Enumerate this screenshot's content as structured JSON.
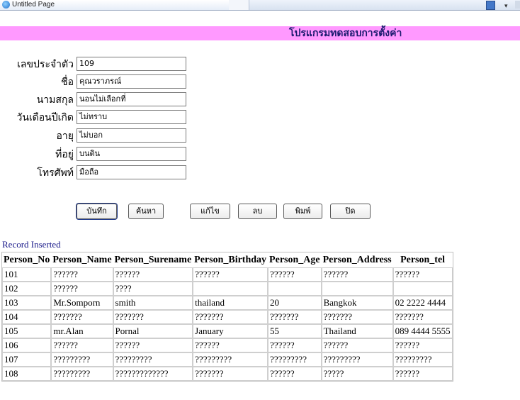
{
  "browser": {
    "tab_title": "Untitled Page"
  },
  "header": {
    "title": "โปรแกรมทดสอบการตั้งค่า",
    "background": "#ff99ff"
  },
  "form": {
    "fields": [
      {
        "label": "เลขประจำตัว",
        "value": "109"
      },
      {
        "label": "ชื่อ",
        "value": "คุณวราภรณ์"
      },
      {
        "label": "นามสกุล",
        "value": "นอนไม่เลือกที่"
      },
      {
        "label": "วันเดือนปีเกิด",
        "value": "ไม่ทราบ"
      },
      {
        "label": "อายุ",
        "value": "ไม่บอก"
      },
      {
        "label": "ที่อยู่",
        "value": "บนดิน"
      },
      {
        "label": "โทรศัพท์",
        "value": "มือถือ"
      }
    ],
    "buttons": {
      "save": "บันทึก",
      "search": "ค้นหา",
      "edit": "แก้ไข",
      "delete": "ลบ",
      "print": "พิมพ์",
      "close": "ปิด"
    }
  },
  "status": "Record Inserted",
  "table": {
    "headers": [
      "Person_No",
      "Person_Name",
      "Person_Surename",
      "Person_Birthday",
      "Person_Age",
      "Person_Address",
      "Person_tel"
    ],
    "rows": [
      [
        "101",
        "??????",
        "??????",
        "??????",
        "??????",
        "??????",
        "??????"
      ],
      [
        "102",
        "??????",
        "????",
        "",
        "",
        "",
        ""
      ],
      [
        "103",
        "Mr.Somporn",
        "smith",
        "thailand",
        "20",
        "Bangkok",
        "02 2222 4444"
      ],
      [
        "104",
        "???????",
        "???????",
        "???????",
        "???????",
        "???????",
        "???????"
      ],
      [
        "105",
        "mr.Alan",
        "Pornal",
        "January",
        "55",
        "Thailand",
        "089 4444 5555"
      ],
      [
        "106",
        "??????",
        "??????",
        "??????",
        "??????",
        "??????",
        "??????"
      ],
      [
        "107",
        "?????????",
        "?????????",
        "?????????",
        "?????????",
        "?????????",
        "?????????"
      ],
      [
        "108",
        "?????????",
        "?????????????",
        "???????",
        "??????",
        "?????",
        "??????"
      ]
    ]
  }
}
